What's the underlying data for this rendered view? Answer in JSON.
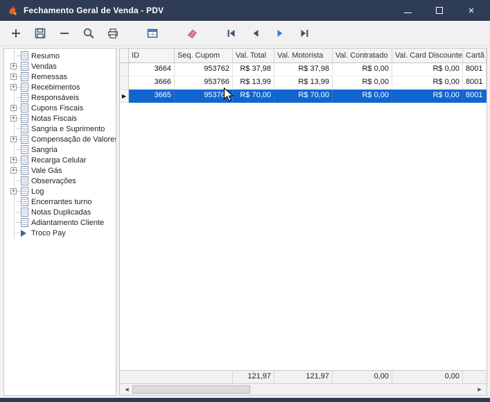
{
  "window": {
    "title": "Fechamento Geral de Venda - PDV",
    "controls": [
      "minimize",
      "maximize",
      "close"
    ]
  },
  "toolbar": {
    "icons": [
      "add",
      "save",
      "delete",
      "search",
      "print-preview",
      "grid-view",
      "clear",
      "first-record",
      "previous-record",
      "next-record",
      "last-record"
    ],
    "accent_blue": "#2f80d8",
    "icon_color": "#44546a"
  },
  "sidebar": {
    "expand_glyph": "+",
    "items": [
      {
        "label": "Resumo",
        "expandable": false
      },
      {
        "label": "Vendas",
        "expandable": true
      },
      {
        "label": "Remessas",
        "expandable": true
      },
      {
        "label": "Recebimentos",
        "expandable": true
      },
      {
        "label": "Responsáveis",
        "expandable": false
      },
      {
        "label": "Cupons Fiscais",
        "expandable": true
      },
      {
        "label": "Notas Fiscais",
        "expandable": true
      },
      {
        "label": "Sangria e Suprimento",
        "expandable": false
      },
      {
        "label": "Compensação de Valores",
        "expandable": true
      },
      {
        "label": "Sangria",
        "expandable": false
      },
      {
        "label": "Recarga Celular",
        "expandable": true
      },
      {
        "label": "Vale Gás",
        "expandable": true
      },
      {
        "label": "Observações",
        "expandable": false
      },
      {
        "label": "Log",
        "expandable": true
      },
      {
        "label": "Encerrantes turno",
        "expandable": false
      },
      {
        "label": "Notas Duplicadas",
        "expandable": false
      },
      {
        "label": "Adiantamento Cliente",
        "expandable": false
      },
      {
        "label": "Troco Pay",
        "expandable": false,
        "icon": "arrow"
      }
    ]
  },
  "grid": {
    "columns": [
      "ID",
      "Seq. Cupom",
      "Val. Total",
      "Val. Motorista",
      "Val. Contratado",
      "Val. Card Discounted",
      "Cartã"
    ],
    "rows": [
      {
        "cells": [
          "3664",
          "953762",
          "R$ 37,98",
          "R$ 37,98",
          "R$ 0,00",
          "R$ 0,00",
          "8001"
        ],
        "selected": false
      },
      {
        "cells": [
          "3666",
          "953766",
          "R$ 13,99",
          "R$ 13,99",
          "R$ 0,00",
          "R$ 0,00",
          "8001"
        ],
        "selected": false
      },
      {
        "cells": [
          "3665",
          "953764",
          "R$ 70,00",
          "R$ 70,00",
          "R$ 0,00",
          "R$ 0,00",
          "8001"
        ],
        "selected": true
      }
    ],
    "selected_marker": "▶",
    "selected_color": "#1165d0",
    "totals": {
      "val_total": "121,97",
      "val_motorista": "121,97",
      "val_contratado": "0,00",
      "val_card": "0,00"
    }
  },
  "scrollbar": {
    "left_glyph": "◀",
    "right_glyph": "▶"
  },
  "colors": {
    "titlebar": "#2e3c55",
    "selection_blue": "#1165d0"
  }
}
